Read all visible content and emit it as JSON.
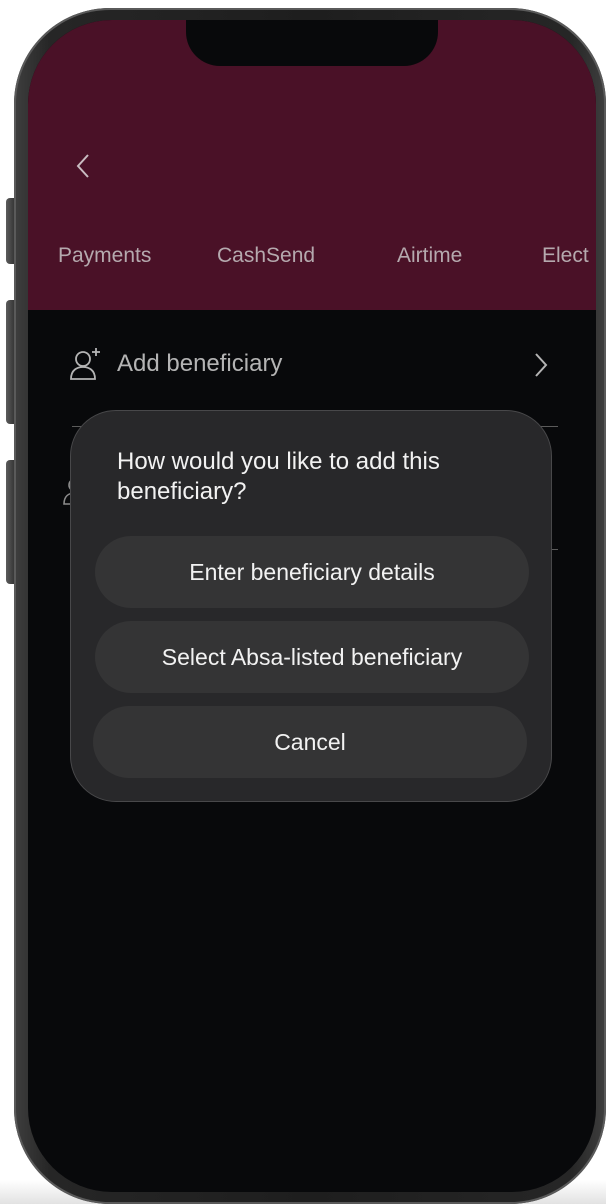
{
  "header": {
    "back_icon": "chevron-left-icon",
    "tabs": [
      {
        "label": "Payments"
      },
      {
        "label": "CashSend"
      },
      {
        "label": "Airtime"
      },
      {
        "label": "Elect"
      }
    ]
  },
  "list": {
    "add_beneficiary": {
      "icon": "add-person-icon",
      "label": "Add beneficiary",
      "chevron": "chevron-right-icon"
    },
    "second_row_icon": "person-icon"
  },
  "dialog": {
    "title": "How would you like to add this beneficiary?",
    "options": [
      {
        "label": "Enter beneficiary details"
      },
      {
        "label": "Select Absa-listed beneficiary"
      }
    ],
    "cancel_label": "Cancel"
  },
  "colors": {
    "header_bg": "#4a1127",
    "screen_bg": "#08090b",
    "dialog_bg": "#28282a",
    "button_bg": "#343435",
    "tab_text": "#b5a9ae"
  }
}
